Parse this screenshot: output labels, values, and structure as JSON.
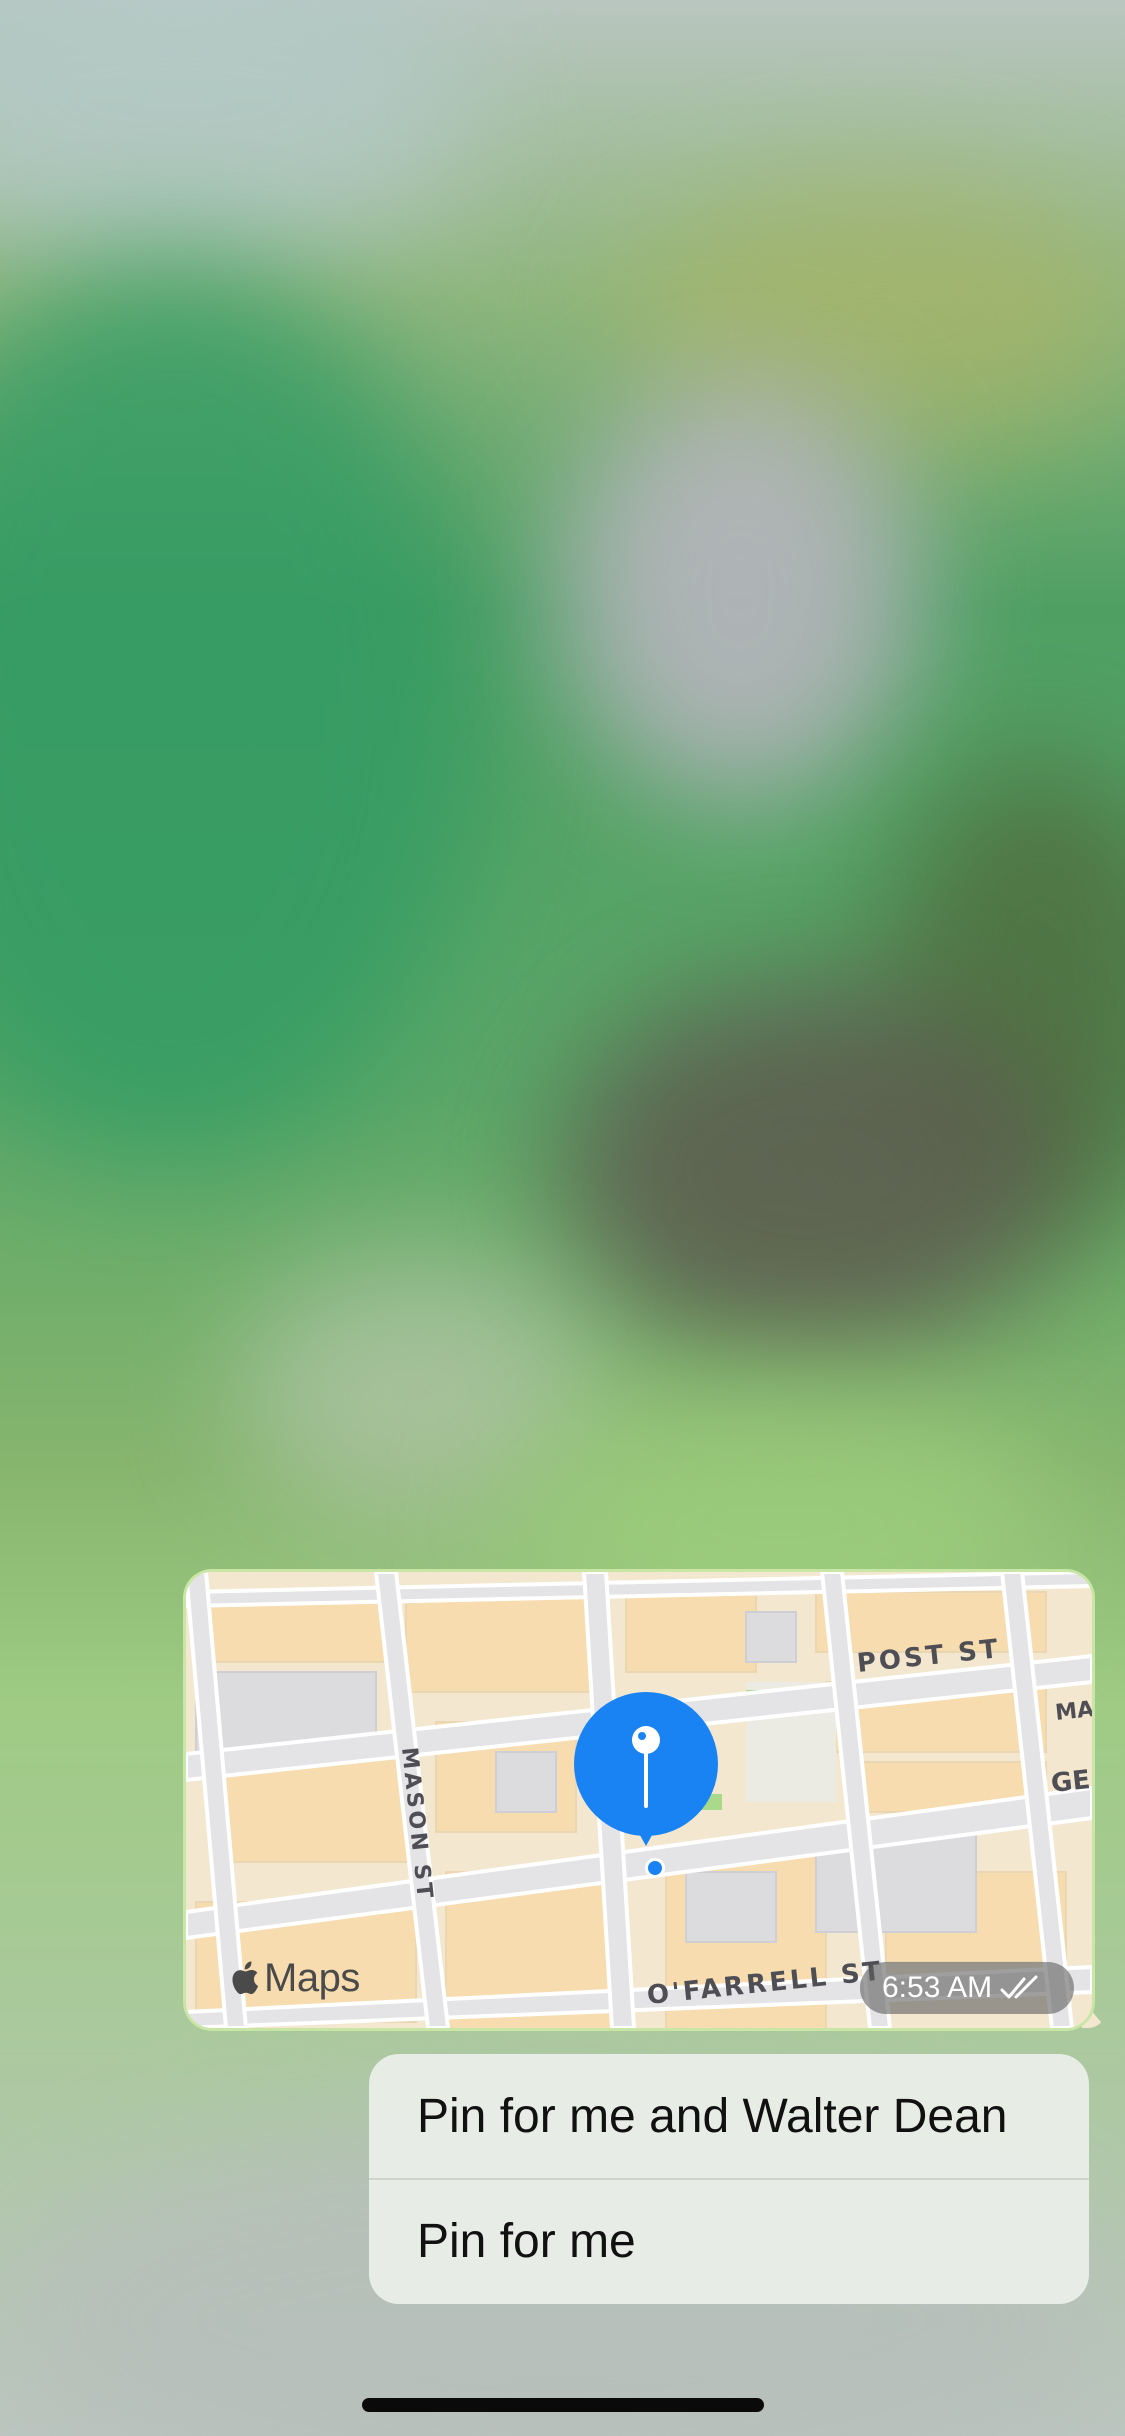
{
  "message": {
    "map": {
      "provider_label": "Maps",
      "streets": {
        "post": "POST ST",
        "mason": "MASON ST",
        "ofarrell": "O'FARRELL ST",
        "partial_right_1": "MA",
        "partial_right_2": "GE"
      }
    },
    "time": "6:53 AM",
    "status_icon": "double-check-icon"
  },
  "context_menu": {
    "items": [
      {
        "label": "Pin for me and Walter Dean"
      },
      {
        "label": "Pin for me"
      }
    ]
  },
  "colors": {
    "pin_blue": "#1a83f4",
    "bubble_border": "#c9e6a7",
    "map_land": "#f3e7cf",
    "map_building": "#f6dcae",
    "road": "#e3e3e6"
  }
}
